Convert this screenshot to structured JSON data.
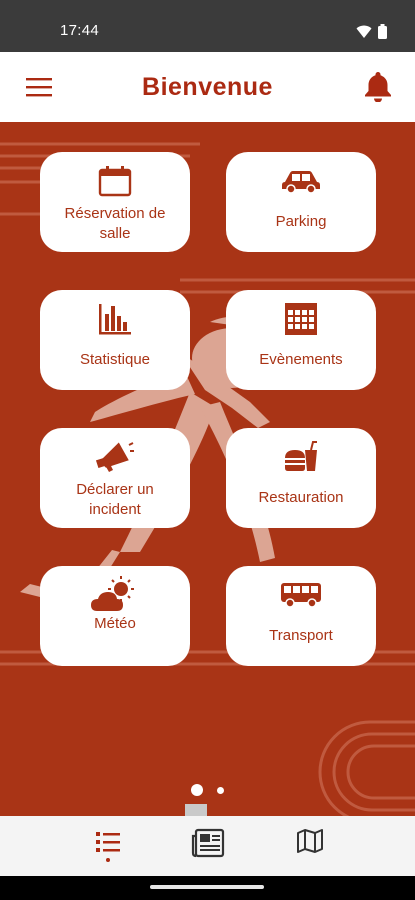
{
  "status_bar": {
    "time": "17:44"
  },
  "header": {
    "title": "Bienvenue"
  },
  "tiles": [
    {
      "label": "Réservation de salle",
      "icon": "calendar-icon"
    },
    {
      "label": "Parking",
      "icon": "car-icon"
    },
    {
      "label": "Statistique",
      "icon": "bar-chart-icon"
    },
    {
      "label": "Evènements",
      "icon": "events-grid-icon"
    },
    {
      "label": "Déclarer un incident",
      "icon": "megaphone-icon"
    },
    {
      "label": "Restauration",
      "icon": "burger-drink-icon"
    },
    {
      "label": "Météo",
      "icon": "sun-cloud-icon"
    },
    {
      "label": "Transport",
      "icon": "bus-icon"
    }
  ],
  "pager": {
    "pages": 2,
    "active_page": 1
  },
  "bottom_nav": [
    {
      "icon": "list-icon",
      "active": true
    },
    {
      "icon": "newspaper-icon",
      "active": false
    },
    {
      "icon": "map-icon",
      "active": false
    }
  ],
  "colors": {
    "brand": "#a93416",
    "title": "#ab2a12",
    "tile_bg": "#ffffff"
  }
}
